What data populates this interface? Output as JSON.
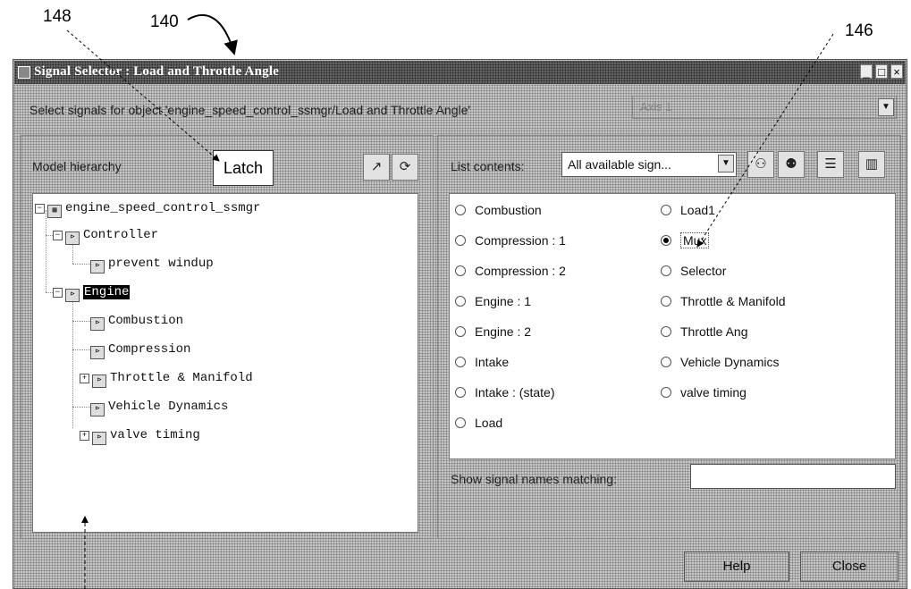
{
  "refs": {
    "r148": "148",
    "r140": "140",
    "r146": "146"
  },
  "window": {
    "title": "Signal Selector : Load and Throttle Angle",
    "controls": {
      "minimize": "_",
      "maximize": "□",
      "close": "×"
    }
  },
  "header": {
    "select_label": "Select signals for object 'engine_speed_control_ssmgr/Load and Throttle Angle'",
    "axis_value": "Axis 1"
  },
  "left": {
    "model_label": "Model hierarchy",
    "latch_label": "Latch",
    "tree": [
      {
        "label": "engine_speed_control_ssmgr"
      },
      {
        "label": "Controller"
      },
      {
        "label": "prevent windup"
      },
      {
        "label": "Engine"
      },
      {
        "label": "Combustion"
      },
      {
        "label": "Compression"
      },
      {
        "label": "Throttle & Manifold"
      },
      {
        "label": "Vehicle Dynamics"
      },
      {
        "label": "valve timing"
      }
    ]
  },
  "right": {
    "list_label": "List contents:",
    "list_value": "All available sign...",
    "signals_col1": [
      "Combustion",
      "Compression : 1",
      "Compression : 2",
      "Engine : 1",
      "Engine : 2",
      "Intake",
      "Intake : (state)",
      "Load"
    ],
    "signals_col2": [
      "Load1",
      "Mux",
      "Selector",
      "Throttle & Manifold",
      "Throttle Ang",
      "Vehicle Dynamics",
      "valve timing"
    ],
    "selected_signal": "Mux",
    "match_label": "Show signal names matching:"
  },
  "footer": {
    "help": "Help",
    "close": "Close"
  }
}
